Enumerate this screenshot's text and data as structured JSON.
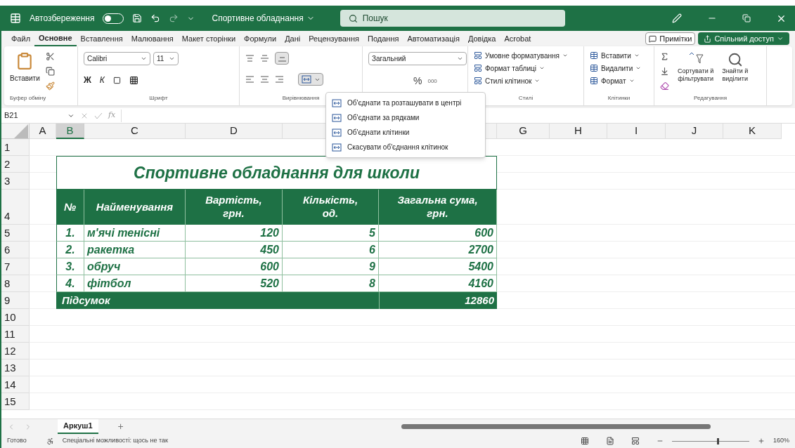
{
  "title_bar": {
    "autosave_label": "Автозбереження",
    "autosave_on": false,
    "file_title": "Спортивне обладнання",
    "search_placeholder": "Пошук"
  },
  "menu_tabs": [
    {
      "label": "Файл",
      "selected": false
    },
    {
      "label": "Основне",
      "selected": true
    },
    {
      "label": "Вставлення",
      "selected": false
    },
    {
      "label": "Малювання",
      "selected": false
    },
    {
      "label": "Макет сторінки",
      "selected": false
    },
    {
      "label": "Формули",
      "selected": false
    },
    {
      "label": "Дані",
      "selected": false
    },
    {
      "label": "Рецензування",
      "selected": false
    },
    {
      "label": "Подання",
      "selected": false
    },
    {
      "label": "Автоматизація",
      "selected": false
    },
    {
      "label": "Довідка",
      "selected": false
    },
    {
      "label": "Acrobat",
      "selected": false
    }
  ],
  "notes_button": "Примітки",
  "share_button": "Спільний доступ",
  "ribbon": {
    "clipboard": {
      "paste": "Вставити",
      "label": "Буфер обміну"
    },
    "font": {
      "name": "Calibri",
      "size": "11",
      "bold": "Ж",
      "italic": "К",
      "label": "Шрифт"
    },
    "alignment": {
      "label": "Вирівнювання",
      "wrap_pressed": true
    },
    "number": {
      "format": "Загальний",
      "percent": "%",
      "thousands": "000"
    },
    "styles": {
      "items": [
        "Умовне форматування",
        "Формат таблиці",
        "Стилі клітинок"
      ],
      "label": "Стилі"
    },
    "cells": {
      "items": [
        "Вставити",
        "Видалити",
        "Формат"
      ],
      "label": "Клітинки"
    },
    "editing": {
      "sort": [
        "Сортувати й",
        "фільтрувати"
      ],
      "find": [
        "Знайти й",
        "виділити"
      ],
      "label": "Редагування"
    }
  },
  "merge_menu": [
    "Об'єднати та розташувати в центрі",
    "Об'єднати за рядками",
    "Об'єднати клітинки",
    "Скасувати об'єднання клітинок"
  ],
  "formula_bar": {
    "name_box": "B21",
    "fx": "fx"
  },
  "columns": [
    {
      "label": "A",
      "selected": false
    },
    {
      "label": "B",
      "selected": true
    },
    {
      "label": "C",
      "selected": false
    },
    {
      "label": "D",
      "selected": false
    },
    {
      "label": "G",
      "selected": false
    },
    {
      "label": "H",
      "selected": false
    },
    {
      "label": "I",
      "selected": false
    },
    {
      "label": "J",
      "selected": false
    },
    {
      "label": "K",
      "selected": false
    }
  ],
  "rows": [
    "1",
    "2",
    "3",
    "4",
    "5",
    "6",
    "7",
    "8",
    "9",
    "10",
    "11",
    "12",
    "13",
    "14",
    "15"
  ],
  "table": {
    "title": "Спортивне обладнання для школи",
    "headers": [
      [
        "№"
      ],
      [
        "Найменування"
      ],
      [
        "Вартість,",
        "грн."
      ],
      [
        "Кількість,",
        "од."
      ],
      [
        "Загальна сума,",
        "грн."
      ]
    ],
    "rows": [
      [
        "1.",
        "м'ячі тенісні",
        "120",
        "5",
        "600"
      ],
      [
        "2.",
        "ракетка",
        "450",
        "6",
        "2700"
      ],
      [
        "3.",
        "обруч",
        "600",
        "9",
        "5400"
      ],
      [
        "4.",
        "фітбол",
        "520",
        "8",
        "4160"
      ]
    ],
    "total_label": "Підсумок",
    "total_value": "12860"
  },
  "sheet_tabs": [
    {
      "label": "Аркуш1",
      "selected": true
    }
  ],
  "add_sheet": "+",
  "status_bar": {
    "ready": "Готово",
    "accessibility": "Спеціальні можливості: щось не так",
    "zoom": "160%",
    "zoom_slider": {
      "level": 0.6
    }
  }
}
